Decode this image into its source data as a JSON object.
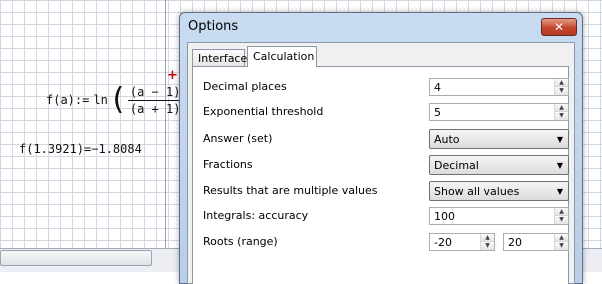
{
  "worksheet": {
    "formula_lhs": "f(a):=",
    "formula_fn": "ln",
    "formula_num": "(a − 1)",
    "formula_den": "(a + 1)",
    "result_text": "f(1.3921)=−1.8084",
    "cursor_glyph": "+"
  },
  "dialog": {
    "title": "Options",
    "close_glyph": "✕",
    "tabs": [
      {
        "label": "Interface"
      },
      {
        "label": "Calculation"
      }
    ],
    "settings": {
      "decimal_places": {
        "label": "Decimal places",
        "value": "4"
      },
      "exp_threshold": {
        "label": "Exponential threshold",
        "value": "5"
      },
      "answer_set": {
        "label": "Answer (set)",
        "value": "Auto"
      },
      "fractions": {
        "label": "Fractions",
        "value": "Decimal"
      },
      "multiple_values": {
        "label": "Results that are multiple values",
        "value": "Show all values"
      },
      "integrals_accuracy": {
        "label": "Integrals: accuracy",
        "value": "100"
      },
      "roots_range": {
        "label": "Roots (range)",
        "min": "-20",
        "max": "20"
      }
    }
  },
  "icons": {
    "spin_up": "▲",
    "spin_down": "▼",
    "dropdown": "▼"
  },
  "colors": {
    "close_button": "#c4452d",
    "title_bar": "#c9dbf0",
    "cursor": "#cc0000"
  }
}
